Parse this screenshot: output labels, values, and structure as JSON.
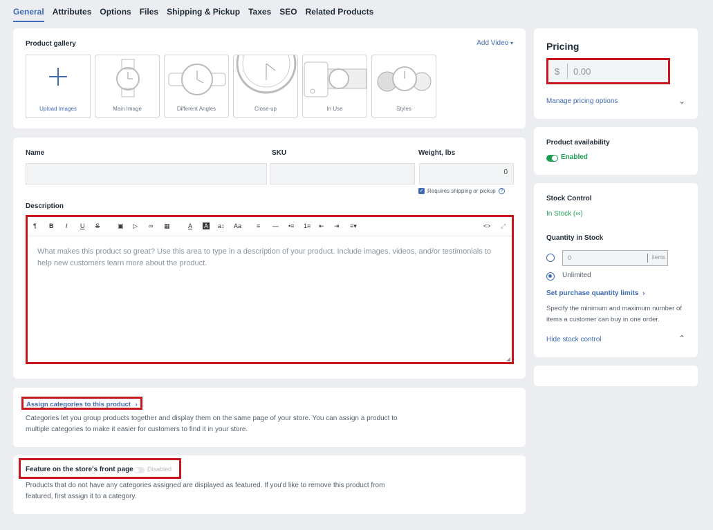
{
  "tabs": [
    "General",
    "Attributes",
    "Options",
    "Files",
    "Shipping & Pickup",
    "Taxes",
    "SEO",
    "Related Products"
  ],
  "gallery": {
    "title": "Product gallery",
    "add_video": "Add Video",
    "tiles": [
      "Upload Images",
      "Main Image",
      "Different Angles",
      "Close-up",
      "In Use",
      "Styles"
    ]
  },
  "fields": {
    "name_label": "Name",
    "sku_label": "SKU",
    "weight_label": "Weight, lbs",
    "weight_value": "0",
    "requires_shipping": "Requires shipping or pickup",
    "description_label": "Description",
    "description_placeholder": "What makes this product so great? Use this area to type in a description of your product. Include images, videos, and/or testimonials to help new customers learn more about the product."
  },
  "categories": {
    "link": "Assign categories to this product",
    "text": "Categories let you group products together and display them on the same page of your store. You can assign a product to multiple categories to make it easier for customers to find it in your store."
  },
  "featured": {
    "title": "Feature on the store's front page",
    "toggle": "Disabled",
    "text": "Products that do not have any categories assigned are displayed as featured. If you'd like to remove this product from featured, first assign it to a category."
  },
  "pricing": {
    "title": "Pricing",
    "currency": "$",
    "price_placeholder": "0.00",
    "manage": "Manage pricing options"
  },
  "availability": {
    "title": "Product availability",
    "status": "Enabled"
  },
  "stock": {
    "title": "Stock Control",
    "status": "In Stock (∞)",
    "qty_title": "Quantity in Stock",
    "qty_placeholder": "0",
    "qty_unit": "items",
    "unlimited": "Unlimited",
    "limits_link": "Set purchase quantity limits",
    "limits_text": "Specify the minimum and maximum number of items a customer can buy in one order.",
    "hide": "Hide stock control"
  },
  "colors": {
    "accent": "#3f6bb5",
    "highlight": "#c8161d",
    "success": "#1f9d55"
  }
}
